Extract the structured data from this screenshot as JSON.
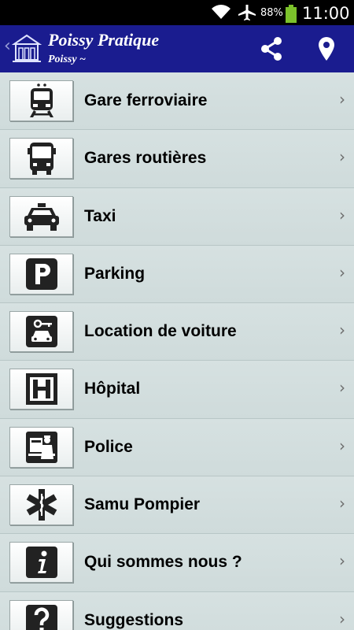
{
  "status_bar": {
    "battery_percent": "88%",
    "time": "11:00",
    "icons": [
      "wifi-icon",
      "airplane-icon",
      "battery-icon"
    ]
  },
  "action_bar": {
    "title": "Poissy Pratique",
    "subtitle": "Poissy ~",
    "back_chevron": "‹",
    "icons": [
      "app-logo-icon",
      "share-icon",
      "location-pin-icon"
    ]
  },
  "colors": {
    "action_bar_bg": "#1a1c8f",
    "list_bg": "#d0dcdc",
    "icon_dark": "#222222"
  },
  "list": {
    "chevron": "›",
    "items": [
      {
        "label": "Gare ferroviaire",
        "icon": "train-icon"
      },
      {
        "label": "Gares routières",
        "icon": "bus-icon"
      },
      {
        "label": "Taxi",
        "icon": "taxi-icon"
      },
      {
        "label": "Parking",
        "icon": "parking-icon"
      },
      {
        "label": "Location de voiture",
        "icon": "car-rental-icon"
      },
      {
        "label": "Hôpital",
        "icon": "hospital-icon"
      },
      {
        "label": "Police",
        "icon": "police-icon"
      },
      {
        "label": "Samu Pompier",
        "icon": "star-of-life-icon"
      },
      {
        "label": "Qui sommes nous ?",
        "icon": "info-icon"
      },
      {
        "label": "Suggestions",
        "icon": "question-icon"
      }
    ]
  }
}
